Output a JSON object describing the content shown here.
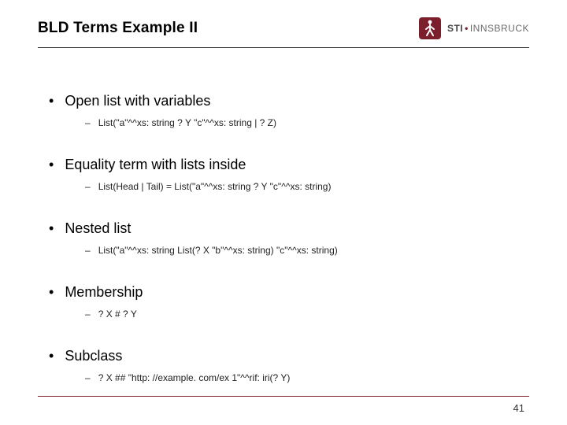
{
  "header": {
    "title": "BLD Terms Example II",
    "logo": {
      "brand": "STI",
      "suffix": "INNSBRUCK"
    }
  },
  "bullets": [
    {
      "heading": "Open list with variables",
      "sub": "List(\"a\"^^xs: string ? Y \"c\"^^xs: string | ? Z)"
    },
    {
      "heading": "Equality term with lists inside",
      "sub": "List(Head | Tail) = List(\"a\"^^xs: string ? Y \"c\"^^xs: string)"
    },
    {
      "heading": "Nested list",
      "sub": "List(\"a\"^^xs: string List(? X \"b\"^^xs: string) \"c\"^^xs: string)"
    },
    {
      "heading": "Membership",
      "sub": "? X # ? Y"
    },
    {
      "heading": "Subclass",
      "sub": "? X ## \"http: //example. com/ex 1\"^^rif: iri(? Y)"
    }
  ],
  "page_number": "41",
  "colors": {
    "accent": "#7a1f2b"
  }
}
